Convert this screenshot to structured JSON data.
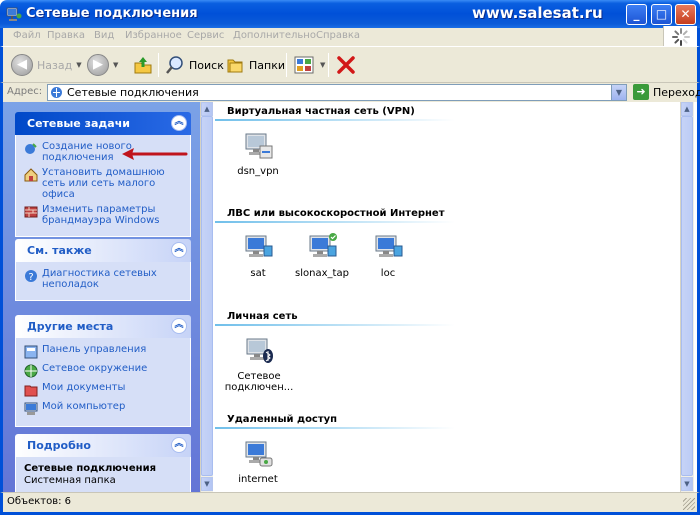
{
  "window": {
    "title": "Сетевые подключения",
    "watermark": "www.salesat.ru",
    "minimize": "_",
    "maximize": "□",
    "close": "✕"
  },
  "menu": [
    "Файл",
    "Правка",
    "Вид",
    "Избранное",
    "Сервис",
    "Дополнительно",
    "Справка"
  ],
  "toolbar": {
    "back_label": "Назад",
    "search_label": "Поиск",
    "folders_label": "Папки"
  },
  "address": {
    "label": "Адрес:",
    "value": "Сетевые подключения",
    "go_label": "Переход"
  },
  "left_panels": {
    "network_tasks": {
      "title": "Сетевые задачи",
      "items": [
        "Создание нового подключения",
        "Установить домашнюю сеть или сеть малого офиса",
        "Изменить параметры брандмауэра Windows"
      ]
    },
    "see_also": {
      "title": "См. также",
      "items": [
        "Диагностика сетевых неполадок"
      ]
    },
    "other_places": {
      "title": "Другие места",
      "items": [
        "Панель управления",
        "Сетевое окружение",
        "Мои документы",
        "Мой компьютер"
      ]
    },
    "details": {
      "title": "Подробно",
      "name": "Сетевые подключения",
      "type": "Системная папка"
    }
  },
  "groups": [
    {
      "title": "Виртуальная частная сеть (VPN)",
      "items": [
        "dsn_vpn"
      ]
    },
    {
      "title": "ЛВС или высокоскоростной Интернет",
      "items": [
        "sat",
        "slonax_tap",
        "loc"
      ]
    },
    {
      "title": "Личная сеть",
      "items": [
        "Сетевое подключен..."
      ]
    },
    {
      "title": "Удаленный доступ",
      "items": [
        "internet"
      ]
    }
  ],
  "status": {
    "text": "Объектов: 6"
  },
  "colors": {
    "title_blue": "#0050d8",
    "task_link": "#215dc6",
    "panel_bg": "#d6dff7",
    "arrow_red": "#c0141c",
    "chrome": "#ece9d8"
  }
}
